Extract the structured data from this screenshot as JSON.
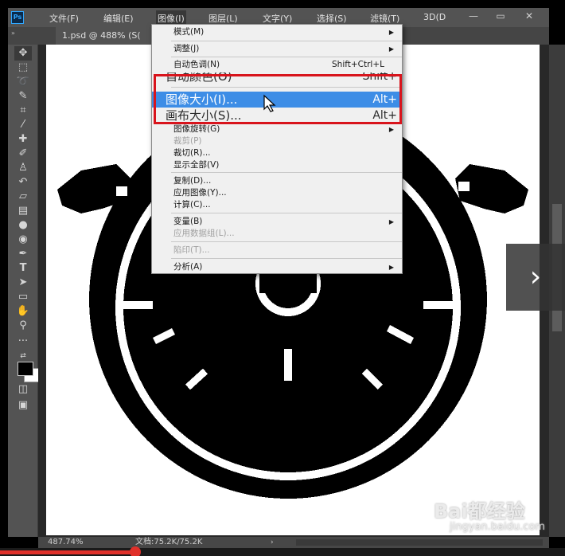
{
  "app": {
    "logo": "Ps"
  },
  "menubar": {
    "items": [
      "文件(F)",
      "编辑(E)",
      "图像(I)",
      "图层(L)",
      "文字(Y)",
      "选择(S)",
      "滤镜(T)",
      "3D(D"
    ],
    "active": "图像(I)"
  },
  "window_controls": {
    "minimize": "—",
    "restore": "▭",
    "close": "✕"
  },
  "optionsbar": {
    "collapse": "»"
  },
  "document_tab": {
    "title": "1.psd @ 488% (S("
  },
  "image_menu": {
    "items": [
      {
        "label": "模式(M)",
        "submenu": true
      },
      {
        "label": "调整(J)",
        "submenu": true
      },
      {
        "label": "自动色调(N)",
        "shortcut": "Shift+Ctrl+L"
      },
      {
        "label": "自动颜色(O)",
        "shortcut": "Shift+"
      },
      {
        "label": "图像大小(I)...",
        "shortcut": "Alt+"
      },
      {
        "label": "画布大小(S)...",
        "shortcut": "Alt+"
      },
      {
        "label": "图像旋转(G)",
        "submenu": true
      },
      {
        "label": "裁剪(P)",
        "disabled": true
      },
      {
        "label": "裁切(R)..."
      },
      {
        "label": "显示全部(V)"
      },
      {
        "label": "复制(D)..."
      },
      {
        "label": "应用图像(Y)..."
      },
      {
        "label": "计算(C)..."
      },
      {
        "label": "变量(B)",
        "submenu": true
      },
      {
        "label": "应用数据组(L)...",
        "disabled": true
      },
      {
        "label": "陷印(T)...",
        "disabled": true
      },
      {
        "label": "分析(A)",
        "submenu": true
      }
    ],
    "highlighted": "图像大小(I)..."
  },
  "statusbar": {
    "zoom": "487.74%",
    "doc_info": "文档:75.2K/75.2K",
    "arrow": "›"
  },
  "video_progress": {
    "fraction": 0.24
  },
  "overlay": {
    "next_arrow": "›"
  },
  "watermark": {
    "logo": "Bai都经验",
    "url": "jingyan.baidu.com"
  },
  "colors": {
    "menu_highlight": "#3d8de6",
    "annotation_box": "#d8141c",
    "ps_blue": "#31a8ff"
  }
}
